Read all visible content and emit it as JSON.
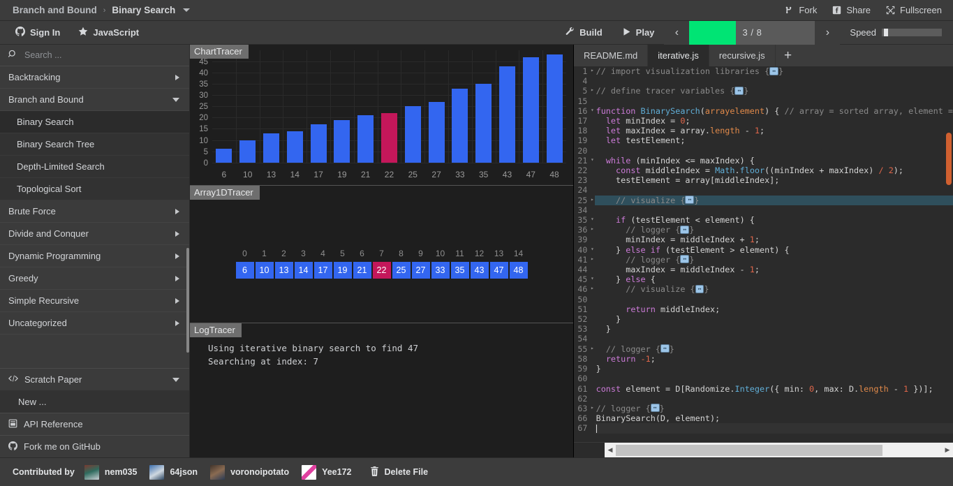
{
  "topbar": {
    "breadcrumb": {
      "category": "Branch and Bound",
      "separator": "›",
      "algorithm": "Binary Search"
    },
    "actions": [
      {
        "label": "Fork",
        "icon": "fork-icon"
      },
      {
        "label": "Share",
        "icon": "facebook-icon"
      },
      {
        "label": "Fullscreen",
        "icon": "fullscreen-icon"
      }
    ]
  },
  "secondbar": {
    "sign_in": "Sign In",
    "language": "JavaScript",
    "build": "Build",
    "play": "Play",
    "prev": "‹",
    "next": "›",
    "step_label": "3 / 8",
    "progress_percent": 37,
    "speed_label": "Speed",
    "speed_percent": 3,
    "accent_green": "#00e474"
  },
  "sidebar": {
    "search_placeholder": "Search ...",
    "search_value": "",
    "categories": [
      {
        "label": "Backtracking",
        "expanded": false
      },
      {
        "label": "Branch and Bound",
        "expanded": true,
        "children": [
          {
            "label": "Binary Search",
            "selected": true
          },
          {
            "label": "Binary Search Tree",
            "selected": false
          },
          {
            "label": "Depth-Limited Search",
            "selected": false
          },
          {
            "label": "Topological Sort",
            "selected": false
          }
        ]
      },
      {
        "label": "Brute Force",
        "expanded": false
      },
      {
        "label": "Divide and Conquer",
        "expanded": false
      },
      {
        "label": "Dynamic Programming",
        "expanded": false
      },
      {
        "label": "Greedy",
        "expanded": false
      },
      {
        "label": "Simple Recursive",
        "expanded": false
      },
      {
        "label": "Uncategorized",
        "expanded": false
      }
    ],
    "scratch_paper": {
      "label": "Scratch Paper",
      "new_item": "New ..."
    },
    "links": [
      {
        "label": "API Reference",
        "icon": "book-icon"
      },
      {
        "label": "Fork me on GitHub",
        "icon": "github-icon"
      }
    ]
  },
  "visualizer": {
    "chart_title": "ChartTracer",
    "array_title": "Array1DTracer",
    "log_title": "LogTracer",
    "log_lines": [
      "Using iterative binary search to find 47",
      "Searching at index: 7"
    ],
    "array": {
      "indices": [
        0,
        1,
        2,
        3,
        4,
        5,
        6,
        7,
        8,
        9,
        10,
        11,
        12,
        13,
        14
      ],
      "values": [
        6,
        10,
        13,
        14,
        17,
        19,
        21,
        22,
        25,
        27,
        33,
        35,
        43,
        47,
        48
      ],
      "selected_index": 7,
      "cell_color": "#3366f0",
      "selected_color": "#c4175a"
    }
  },
  "chart_data": {
    "type": "bar",
    "title": "ChartTracer",
    "categories": [
      "6",
      "10",
      "13",
      "14",
      "17",
      "19",
      "21",
      "22",
      "25",
      "27",
      "33",
      "35",
      "43",
      "47",
      "48"
    ],
    "values": [
      6,
      10,
      13,
      14,
      17,
      19,
      21,
      22,
      25,
      27,
      33,
      35,
      43,
      47,
      48
    ],
    "highlight_index": 7,
    "bar_color": "#3366f0",
    "highlight_color": "#c4175a",
    "yticks": [
      0,
      5,
      10,
      15,
      20,
      25,
      30,
      35,
      40,
      45
    ],
    "ylim": [
      0,
      50
    ],
    "xlabel": "",
    "ylabel": "",
    "grid": true,
    "legend": "none"
  },
  "editor": {
    "tabs": [
      {
        "label": "README.md",
        "active": false
      },
      {
        "label": "iterative.js",
        "active": true
      },
      {
        "label": "recursive.js",
        "active": false
      }
    ],
    "add_tab": "+",
    "lines": [
      {
        "n": "1",
        "fold": "▸",
        "hl": false,
        "tokens": [
          [
            "cm",
            "// import visualization libraries {"
          ],
          [
            "badge",
            ""
          ],
          [
            "cm",
            "}"
          ]
        ]
      },
      {
        "n": "4",
        "fold": "",
        "hl": false,
        "tokens": []
      },
      {
        "n": "5",
        "fold": "▸",
        "hl": false,
        "tokens": [
          [
            "cm",
            "// define tracer variables {"
          ],
          [
            "badge",
            ""
          ],
          [
            "cm",
            "}"
          ]
        ]
      },
      {
        "n": "15",
        "fold": "",
        "hl": false,
        "tokens": []
      },
      {
        "n": "16",
        "fold": "▾",
        "hl": false,
        "tokens": [
          [
            "kw",
            "function "
          ],
          [
            "fn",
            "BinarySearch"
          ],
          [
            "plain",
            "("
          ],
          [
            "param",
            "array"
          ],
          [
            "plain][, "
          ],
          [
            "param",
            "element"
          ],
          [
            "plain",
            ") { "
          ],
          [
            "cm",
            "// array = sorted array, element ="
          ]
        ]
      },
      {
        "n": "17",
        "fold": "",
        "hl": false,
        "tokens": [
          [
            "plain",
            "  "
          ],
          [
            "kw",
            "let "
          ],
          [
            "plain",
            "minIndex = "
          ],
          [
            "num",
            "0"
          ],
          [
            "plain",
            ";"
          ]
        ]
      },
      {
        "n": "18",
        "fold": "",
        "hl": false,
        "tokens": [
          [
            "plain",
            "  "
          ],
          [
            "kw",
            "let "
          ],
          [
            "plain",
            "maxIndex = array."
          ],
          [
            "prop",
            "length"
          ],
          [
            "plain",
            " - "
          ],
          [
            "num",
            "1"
          ],
          [
            "plain",
            ";"
          ]
        ]
      },
      {
        "n": "19",
        "fold": "",
        "hl": false,
        "tokens": [
          [
            "plain",
            "  "
          ],
          [
            "kw",
            "let "
          ],
          [
            "plain",
            "testElement;"
          ]
        ]
      },
      {
        "n": "20",
        "fold": "",
        "hl": false,
        "tokens": []
      },
      {
        "n": "21",
        "fold": "▾",
        "hl": false,
        "tokens": [
          [
            "plain",
            "  "
          ],
          [
            "kw",
            "while "
          ],
          [
            "plain",
            "(minIndex <= maxIndex) {"
          ]
        ]
      },
      {
        "n": "22",
        "fold": "",
        "hl": false,
        "tokens": [
          [
            "plain",
            "    "
          ],
          [
            "kw",
            "const "
          ],
          [
            "plain",
            "middleIndex = "
          ],
          [
            "fn",
            "Math"
          ],
          [
            "plain",
            "."
          ],
          [
            "fn",
            "floor"
          ],
          [
            "plain",
            "((minIndex + maxIndex) "
          ],
          [
            "num",
            "/ 2"
          ],
          [
            "plain",
            ");"
          ]
        ]
      },
      {
        "n": "23",
        "fold": "",
        "hl": false,
        "tokens": [
          [
            "plain",
            "    testElement = array[middleIndex];"
          ]
        ]
      },
      {
        "n": "24",
        "fold": "",
        "hl": false,
        "tokens": []
      },
      {
        "n": "25",
        "fold": "▸",
        "hl": true,
        "tokens": [
          [
            "plain",
            "    "
          ],
          [
            "cm",
            "// visualize {"
          ],
          [
            "badge",
            ""
          ],
          [
            "cm",
            "}"
          ]
        ]
      },
      {
        "n": "34",
        "fold": "",
        "hl": false,
        "tokens": []
      },
      {
        "n": "35",
        "fold": "▾",
        "hl": false,
        "tokens": [
          [
            "plain",
            "    "
          ],
          [
            "kw",
            "if "
          ],
          [
            "plain",
            "(testElement < element) {"
          ]
        ]
      },
      {
        "n": "36",
        "fold": "▸",
        "hl": false,
        "tokens": [
          [
            "plain",
            "      "
          ],
          [
            "cm",
            "// logger {"
          ],
          [
            "badge",
            ""
          ],
          [
            "cm",
            "}"
          ]
        ]
      },
      {
        "n": "39",
        "fold": "",
        "hl": false,
        "tokens": [
          [
            "plain",
            "      minIndex = middleIndex + "
          ],
          [
            "num",
            "1"
          ],
          [
            "plain",
            ";"
          ]
        ]
      },
      {
        "n": "40",
        "fold": "▾",
        "hl": false,
        "tokens": [
          [
            "plain",
            "    } "
          ],
          [
            "kw",
            "else if "
          ],
          [
            "plain",
            "(testElement > element) {"
          ]
        ]
      },
      {
        "n": "41",
        "fold": "▸",
        "hl": false,
        "tokens": [
          [
            "plain",
            "      "
          ],
          [
            "cm",
            "// logger {"
          ],
          [
            "badge",
            ""
          ],
          [
            "cm",
            "}"
          ]
        ]
      },
      {
        "n": "44",
        "fold": "",
        "hl": false,
        "tokens": [
          [
            "plain",
            "      maxIndex = middleIndex - "
          ],
          [
            "num",
            "1"
          ],
          [
            "plain",
            ";"
          ]
        ]
      },
      {
        "n": "45",
        "fold": "▾",
        "hl": false,
        "tokens": [
          [
            "plain",
            "    } "
          ],
          [
            "kw",
            "else "
          ],
          [
            "plain",
            "{"
          ]
        ]
      },
      {
        "n": "46",
        "fold": "▸",
        "hl": false,
        "tokens": [
          [
            "plain",
            "      "
          ],
          [
            "cm",
            "// visualize {"
          ],
          [
            "badge",
            ""
          ],
          [
            "cm",
            "}"
          ]
        ]
      },
      {
        "n": "50",
        "fold": "",
        "hl": false,
        "tokens": []
      },
      {
        "n": "51",
        "fold": "",
        "hl": false,
        "tokens": [
          [
            "plain",
            "      "
          ],
          [
            "kw",
            "return "
          ],
          [
            "plain",
            "middleIndex;"
          ]
        ]
      },
      {
        "n": "52",
        "fold": "",
        "hl": false,
        "tokens": [
          [
            "plain",
            "    }"
          ]
        ]
      },
      {
        "n": "53",
        "fold": "",
        "hl": false,
        "tokens": [
          [
            "plain",
            "  }"
          ]
        ]
      },
      {
        "n": "54",
        "fold": "",
        "hl": false,
        "tokens": []
      },
      {
        "n": "55",
        "fold": "▸",
        "hl": false,
        "tokens": [
          [
            "plain",
            "  "
          ],
          [
            "cm",
            "// logger {"
          ],
          [
            "badge",
            ""
          ],
          [
            "cm",
            "}"
          ]
        ]
      },
      {
        "n": "58",
        "fold": "",
        "hl": false,
        "tokens": [
          [
            "plain",
            "  "
          ],
          [
            "kw",
            "return "
          ],
          [
            "num",
            "-1"
          ],
          [
            "plain",
            ";"
          ]
        ]
      },
      {
        "n": "59",
        "fold": "",
        "hl": false,
        "tokens": [
          [
            "plain",
            "}"
          ]
        ]
      },
      {
        "n": "60",
        "fold": "",
        "hl": false,
        "tokens": []
      },
      {
        "n": "61",
        "fold": "",
        "hl": false,
        "tokens": [
          [
            "kw",
            "const "
          ],
          [
            "plain",
            "element = D[Randomize."
          ],
          [
            "fn",
            "Integer"
          ],
          [
            "plain",
            "({ min: "
          ],
          [
            "num",
            "0"
          ],
          [
            "plain",
            ", max: D."
          ],
          [
            "prop",
            "length"
          ],
          [
            "plain",
            " - "
          ],
          [
            "num",
            "1"
          ],
          [
            "plain",
            " })];"
          ]
        ]
      },
      {
        "n": "62",
        "fold": "",
        "hl": false,
        "tokens": []
      },
      {
        "n": "63",
        "fold": "▸",
        "hl": false,
        "tokens": [
          [
            "cm",
            "// logger {"
          ],
          [
            "badge",
            ""
          ],
          [
            "cm",
            "}"
          ]
        ]
      },
      {
        "n": "66",
        "fold": "",
        "hl": false,
        "tokens": [
          [
            "plain",
            "BinarySearch(D, element);"
          ]
        ]
      },
      {
        "n": "67",
        "fold": "",
        "hl": false,
        "cursor": true,
        "tokens": []
      }
    ]
  },
  "footer": {
    "contributed_by": "Contributed by",
    "contributors": [
      {
        "name": "nem035",
        "avatar_color": "#2f6b5e"
      },
      {
        "name": "64json",
        "avatar_color": "#4a79b5"
      },
      {
        "name": "voronoipotato",
        "avatar_color": "#5a4236"
      },
      {
        "name": "Yee172",
        "avatar_color": "#f0f0f0"
      }
    ],
    "delete_file": "Delete File"
  }
}
